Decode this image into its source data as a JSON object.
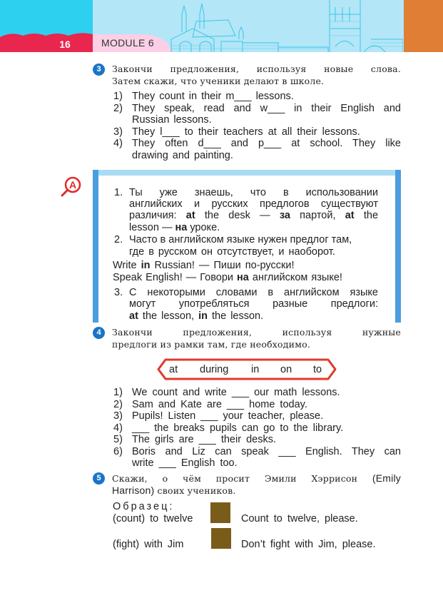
{
  "header": {
    "page_number": "16",
    "module": "MODULE 6",
    "colors": {
      "accent_red": "#e8264e",
      "sky_blue": "#2ed0f0",
      "light_blue": "#b3e6f7",
      "orange": "#e07e35",
      "pink": "#fbd0e6",
      "badge_blue": "#1a75c7"
    }
  },
  "task3": {
    "number": "3",
    "instruction_line1": "Закончи предложения, используя новые слова.",
    "instruction_line2": "Затем скажи, что ученики делают в школе.",
    "items": [
      {
        "num": "1)",
        "lines": [
          "They count in their m___ lessons."
        ]
      },
      {
        "num": "2)",
        "lines": [
          "They speak, read and w___ in their English and",
          "Russian lessons."
        ]
      },
      {
        "num": "3)",
        "lines": [
          "They l___ to their teachers at all their lessons."
        ]
      },
      {
        "num": "4)",
        "lines": [
          "They often d___ and p___ at school. They like",
          "drawing and painting."
        ]
      }
    ]
  },
  "rule": {
    "icon": "magnifier-letter-a-icon",
    "icon_letter": "A",
    "p1_num": "1.",
    "p1_line1": "Ты уже знаешь, что в использовании",
    "p1_line2": "английских и русских предлогов существуют",
    "p1_line3_a": "различия: ",
    "p1_line3_b": "at",
    "p1_line3_c": " the desk — ",
    "p1_line3_d": "за",
    "p1_line3_e": " партой, ",
    "p1_line3_f": "at",
    "p1_line3_g": " the",
    "p1_line4_a": "lesson — ",
    "p1_line4_b": "на",
    "p1_line4_c": " уроке.",
    "p2_num": "2.",
    "p2_line1": "Часто в английском языке нужен предлог там,",
    "p2_line2": "где в русском он отсутствует, и наоборот.",
    "ex1_a": "Write ",
    "ex1_b": "in",
    "ex1_c": " Russian! — Пиши по-русски!",
    "ex2_a": "Speak English! — Говори ",
    "ex2_b": "на",
    "ex2_c": " английском языке!",
    "p3_num": "3.",
    "p3_line1": "С некоторыми словами в английском языке",
    "p3_line2": "могут употребляться разные предлоги:",
    "p3_line3_a": "at",
    "p3_line3_b": " the lesson, ",
    "p3_line3_c": "in",
    "p3_line3_d": " the lesson."
  },
  "task4": {
    "number": "4",
    "instruction_line1": "Закончи предложения, используя нужные",
    "instruction_line2": "предлоги из рамки там, где необходимо.",
    "word_box": [
      "at",
      "during",
      "in",
      "on",
      "to"
    ],
    "items": [
      {
        "num": "1)",
        "lines": [
          "We count and write ___ our math lessons."
        ]
      },
      {
        "num": "2)",
        "lines": [
          "Sam and Kate are ___ home today."
        ]
      },
      {
        "num": "3)",
        "lines": [
          "Pupils! Listen ___ your teacher, please."
        ]
      },
      {
        "num": "4)",
        "lines": [
          "___ the breaks pupils can go to the library."
        ]
      },
      {
        "num": "5)",
        "lines": [
          "The girls are ___ their desks."
        ]
      },
      {
        "num": "6)",
        "lines": [
          "Boris and Liz can speak ___ English. They can",
          "write ___ English too."
        ]
      }
    ]
  },
  "task5": {
    "number": "5",
    "instruction_line1_a": "Скажи, о чём просит Эмили Хэррисон ",
    "instruction_line1_b": "(Emily",
    "instruction_line2_a": "Harrison)",
    "instruction_line2_b": " своих учеников.",
    "sample_label": "Образец:",
    "examples": [
      {
        "prompt": "(count) to twelve",
        "answer": "Count to twelve, please."
      },
      {
        "prompt": "(fight) with Jim",
        "answer": "Don’t fight with Jim, please."
      }
    ],
    "blank_color": "#7a5c1a"
  }
}
